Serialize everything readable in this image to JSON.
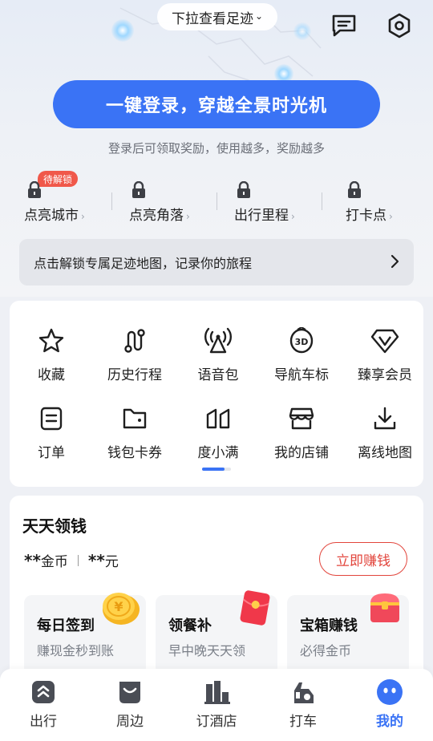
{
  "header": {
    "pull_hint": "下拉查看足迹",
    "pull_chevron": "⌄",
    "message_icon": "message-icon",
    "settings_icon": "settings-hexagon-icon"
  },
  "login": {
    "button_label": "一键登录，穿越全景时光机",
    "subtitle": "登录后可领取奖励，使用越多，奖励越多"
  },
  "footprint_stats": {
    "badge": "待解锁",
    "items": [
      {
        "label": "点亮城市",
        "icon": "lock-icon"
      },
      {
        "label": "点亮角落",
        "icon": "lock-icon"
      },
      {
        "label": "出行里程",
        "icon": "lock-icon"
      },
      {
        "label": "打卡点",
        "icon": "lock-icon"
      }
    ]
  },
  "unlock_bar": {
    "text": "点击解锁专属足迹地图，记录你的旅程"
  },
  "tools": {
    "row1": [
      {
        "label": "收藏",
        "icon": "star-icon"
      },
      {
        "label": "历史行程",
        "icon": "route-icon"
      },
      {
        "label": "语音包",
        "icon": "voice-broadcast-icon"
      },
      {
        "label": "导航车标",
        "icon": "3d-car-marker-icon"
      },
      {
        "label": "臻享会员",
        "icon": "vip-diamond-icon"
      }
    ],
    "row2": [
      {
        "label": "订单",
        "icon": "order-icon"
      },
      {
        "label": "钱包卡券",
        "icon": "wallet-icon"
      },
      {
        "label": "度小满",
        "icon": "duxiaoman-icon"
      },
      {
        "label": "我的店铺",
        "icon": "store-icon"
      },
      {
        "label": "离线地图",
        "icon": "download-icon"
      }
    ],
    "page_indicator": {
      "pages": 2,
      "current": 1
    }
  },
  "earn": {
    "title": "天天领钱",
    "coins_value": "**",
    "coins_unit": "金币",
    "cash_value": "**",
    "cash_unit": "元",
    "button": "立即赚钱",
    "tasks": [
      {
        "title": "每日签到",
        "desc": "赚现金秒到账",
        "icon": "gold-coin-icon"
      },
      {
        "title": "领餐补",
        "desc": "早中晚天天领",
        "icon": "red-envelope-icon"
      },
      {
        "title": "宝箱赚钱",
        "desc": "必得金币",
        "icon": "treasure-chest-icon"
      }
    ]
  },
  "tabbar": {
    "items": [
      {
        "label": "出行",
        "icon": "travel-icon",
        "active": false
      },
      {
        "label": "周边",
        "icon": "nearby-icon",
        "active": false
      },
      {
        "label": "订酒店",
        "icon": "hotel-icon",
        "active": false
      },
      {
        "label": "打车",
        "icon": "taxi-icon",
        "active": false
      },
      {
        "label": "我的",
        "icon": "profile-face-icon",
        "active": true
      }
    ]
  },
  "colors": {
    "accent": "#3a73f5",
    "badge_red": "#f0584a",
    "earn_red": "#e2453c",
    "background": "#eef0f5"
  }
}
